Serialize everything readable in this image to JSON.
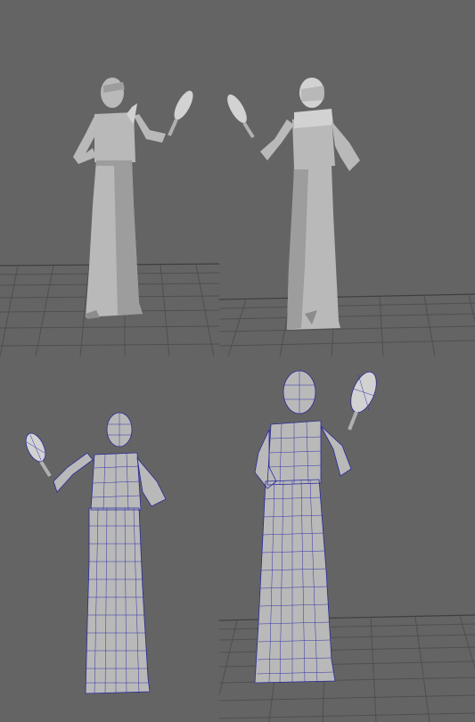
{
  "viewports": [
    {
      "name": "top-left",
      "mode": "shaded",
      "view": "front"
    },
    {
      "name": "top-right",
      "mode": "shaded",
      "view": "back"
    },
    {
      "name": "bottom-left",
      "mode": "wireframe-on-shaded",
      "view": "back"
    },
    {
      "name": "bottom-right",
      "mode": "wireframe-on-shaded",
      "view": "front"
    }
  ],
  "colors": {
    "background": "#646464",
    "grid": "#4f4f4f",
    "model": "#b9b9b9",
    "wireframe": "#2a2a9a"
  },
  "icons": [
    "figure-model-icon",
    "hand-mirror-icon"
  ]
}
